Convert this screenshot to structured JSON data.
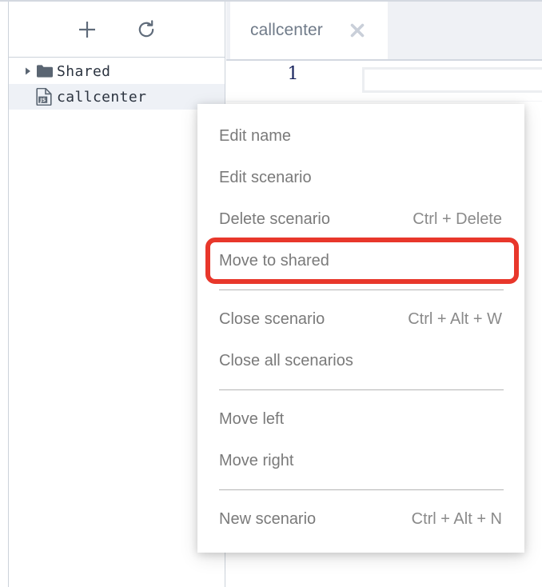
{
  "sidebar": {
    "toolbar": {
      "add_label": "+",
      "add_icon": "plus-icon",
      "refresh_icon": "refresh-icon"
    },
    "tree": [
      {
        "label": "Shared",
        "icon": "folder-icon",
        "caret": "caret-right-icon",
        "selected": false,
        "indent": false
      },
      {
        "label": "callcenter",
        "icon": "js-file-icon",
        "caret": "",
        "selected": true,
        "indent": true
      }
    ]
  },
  "tabs": [
    {
      "label": "callcenter",
      "close_icon": "close-icon",
      "active": true
    }
  ],
  "editor": {
    "line_number": "1",
    "code_value": "",
    "code_placeholder": ""
  },
  "context_menu": {
    "items": [
      {
        "label": "Edit name",
        "shortcut": "",
        "highlighted": false,
        "separator_after": false
      },
      {
        "label": "Edit scenario",
        "shortcut": "",
        "highlighted": false,
        "separator_after": false
      },
      {
        "label": "Delete scenario",
        "shortcut": "Ctrl + Delete",
        "highlighted": false,
        "separator_after": false
      },
      {
        "label": "Move to shared",
        "shortcut": "",
        "highlighted": true,
        "separator_after": true
      },
      {
        "label": "Close scenario",
        "shortcut": "Ctrl + Alt + W",
        "highlighted": false,
        "separator_after": false
      },
      {
        "label": "Close all scenarios",
        "shortcut": "",
        "highlighted": false,
        "separator_after": true
      },
      {
        "label": "Move left",
        "shortcut": "",
        "highlighted": false,
        "separator_after": false
      },
      {
        "label": "Move right",
        "shortcut": "",
        "highlighted": false,
        "separator_after": true
      },
      {
        "label": "New scenario",
        "shortcut": "Ctrl + Alt + N",
        "highlighted": false,
        "separator_after": false
      }
    ]
  },
  "colors": {
    "highlight_red": "#E8372B",
    "tabbar_bg": "#EFF1F5",
    "selected_row_bg": "#EEF1F6",
    "line_number": "#16225C",
    "menu_text": "#7A7A7A"
  }
}
